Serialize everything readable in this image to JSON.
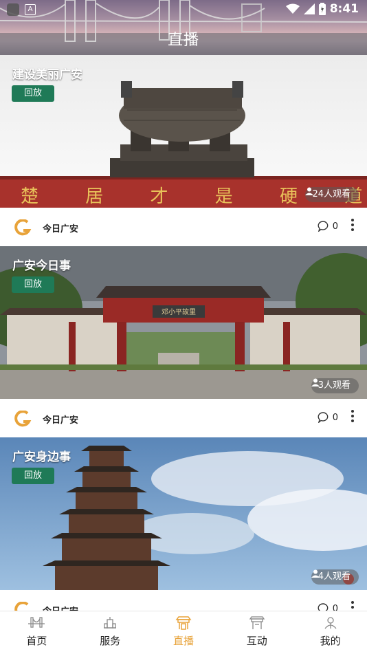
{
  "status_bar": {
    "time": "8:41",
    "keyboard_indicator": "A"
  },
  "header": {
    "title": "直播"
  },
  "cards": [
    {
      "title": "建设美丽广安",
      "badge": "回放",
      "viewers": "24人观看",
      "source": "今日广安",
      "comments": "0",
      "banner_text": "楚 居 才 是 硬 道 理"
    },
    {
      "title": "广安今日事",
      "badge": "回放",
      "viewers": "3人观看",
      "source": "今日广安",
      "comments": "0",
      "gate_plaque": "邓小平故里"
    },
    {
      "title": "广安身边事",
      "badge": "回放",
      "viewers": "4人观看",
      "source": "今日广安",
      "comments": "0"
    }
  ],
  "tabbar": {
    "items": [
      {
        "label": "首页",
        "icon": "bridge-icon",
        "active": false
      },
      {
        "label": "服务",
        "icon": "building-icon",
        "active": false
      },
      {
        "label": "直播",
        "icon": "live-gate-icon",
        "active": true
      },
      {
        "label": "互动",
        "icon": "gate-icon",
        "active": false
      },
      {
        "label": "我的",
        "icon": "profile-icon",
        "active": false
      }
    ]
  },
  "colors": {
    "accent": "#e8a33a",
    "badge": "#1f7a57"
  }
}
